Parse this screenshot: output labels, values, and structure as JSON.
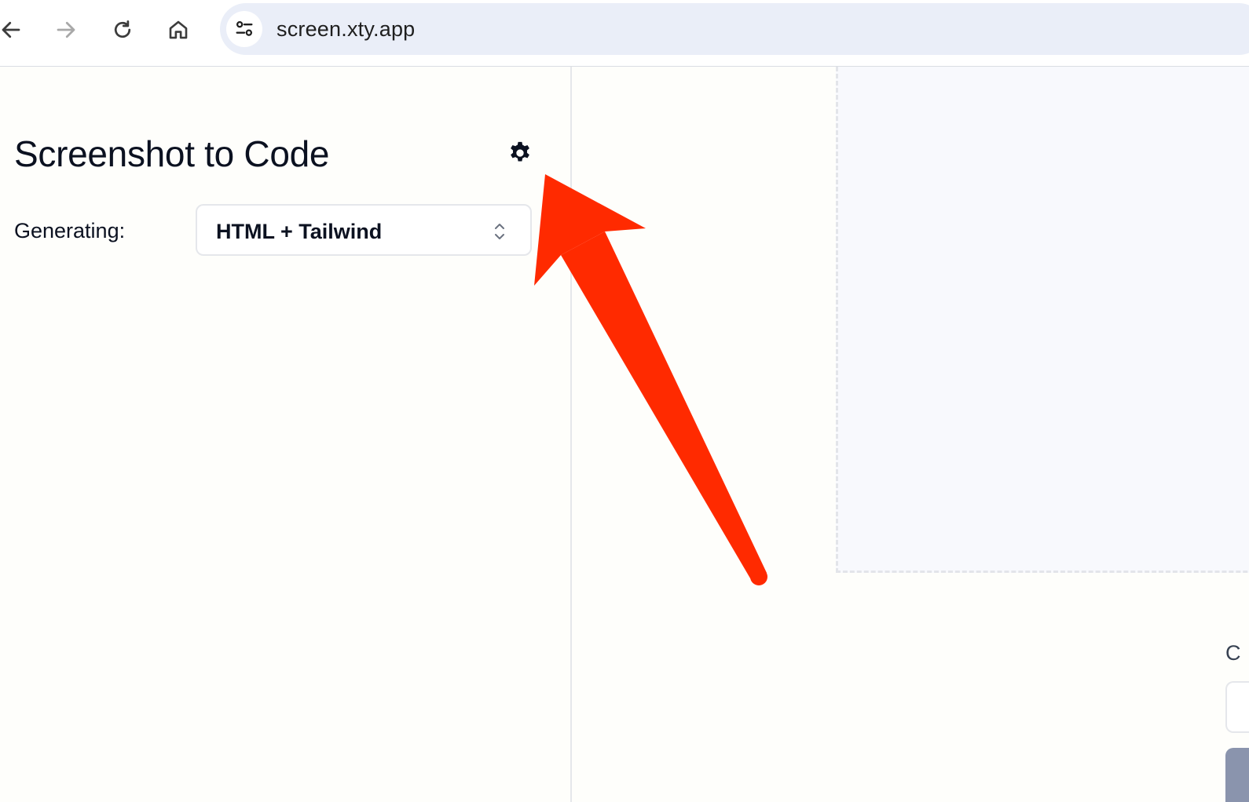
{
  "browser": {
    "url": "screen.xty.app",
    "icons": {
      "back": "arrow-left-icon",
      "forward": "arrow-right-icon",
      "reload": "reload-icon",
      "home": "home-icon",
      "site_info": "tune-sliders-icon"
    }
  },
  "sidebar": {
    "title": "Screenshot to Code",
    "settings_icon": "gear-icon",
    "generating_label": "Generating:",
    "stack_select": {
      "value": "HTML + Tailwind",
      "icon": "chevron-up-down-icon"
    }
  },
  "main": {
    "edge_letter": "C"
  },
  "annotation": {
    "type": "arrow",
    "color": "#ff2a00",
    "points_to": "settings-gear"
  },
  "colors": {
    "page_bg": "#fefefb",
    "omnibox_bg": "#eaeef8",
    "drop_zone_bg": "#f8f9fd",
    "text": "#0b1120",
    "arrow": "#ff2a00"
  }
}
